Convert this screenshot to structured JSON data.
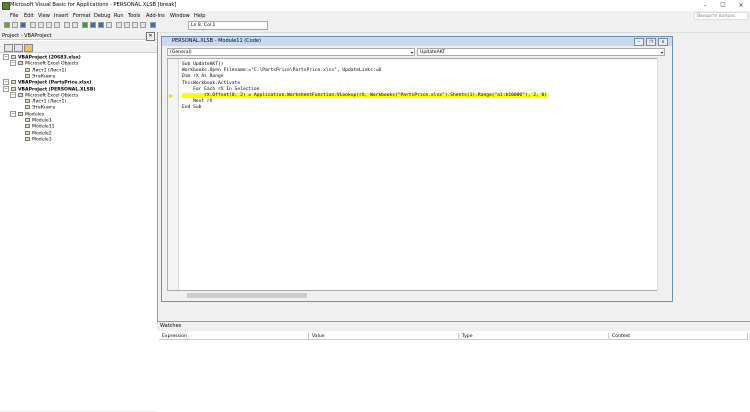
{
  "window": {
    "title": "Microsoft Visual Basic for Applications - PERSONAL.XLSB [break]",
    "controls": [
      "–",
      "☐",
      "✕"
    ]
  },
  "menu": {
    "items": [
      "File",
      "Edit",
      "View",
      "Insert",
      "Format",
      "Debug",
      "Run",
      "Tools",
      "Add-Ins",
      "Window",
      "Help"
    ],
    "ask_placeholder": "Введите вопрос"
  },
  "toolbar": {
    "position": "Ln 8, Col 1"
  },
  "project": {
    "title": "Project - VBAProject",
    "close": "✕",
    "tree": [
      {
        "label": "VBAProject (20683.xlsx)",
        "bold": true,
        "level": 0,
        "icon": "project-icon"
      },
      {
        "label": "Microsoft Excel Objects",
        "bold": false,
        "level": 1,
        "icon": "folder-icon"
      },
      {
        "label": "Лист1 (Лист1)",
        "bold": false,
        "level": 2,
        "icon": "sheet-icon"
      },
      {
        "label": "ЭтаКнига",
        "bold": false,
        "level": 2,
        "icon": "workbook-icon"
      },
      {
        "label": "VBAProject (PartsPrice.xlsx)",
        "bold": true,
        "level": 0,
        "icon": "project-icon"
      },
      {
        "label": "VBAProject (PERSONAL.XLSB)",
        "bold": true,
        "level": 0,
        "icon": "project-icon"
      },
      {
        "label": "Microsoft Excel Objects",
        "bold": false,
        "level": 1,
        "icon": "folder-icon"
      },
      {
        "label": "Лист1 (Лист1)",
        "bold": false,
        "level": 2,
        "icon": "sheet-icon"
      },
      {
        "label": "ЭтаКнига",
        "bold": false,
        "level": 2,
        "icon": "workbook-icon"
      },
      {
        "label": "Modules",
        "bold": false,
        "level": 1,
        "icon": "folder-icon"
      },
      {
        "label": "Module1",
        "bold": false,
        "level": 2,
        "icon": "module-icon"
      },
      {
        "label": "Module11",
        "bold": false,
        "level": 2,
        "icon": "module-icon"
      },
      {
        "label": "Module2",
        "bold": false,
        "level": 2,
        "icon": "module-icon"
      },
      {
        "label": "Module3",
        "bold": false,
        "level": 2,
        "icon": "module-icon"
      }
    ]
  },
  "code_window": {
    "title": "PERSONAL.XLSB - Module11 (Code)",
    "object_combo": "(General)",
    "proc_combo": "UpdateAKT",
    "lines": [
      "Sub UpdateAKT()",
      "Workbooks.Open Filename:=\"C:\\PartsPrice\\PartsPrice.xlsx\", UpdateLinks:=0",
      "Dim rX As Range",
      "ThisWorkbook.Activate",
      "    For Each rX In Selection",
      "        rX.Offset(0, 2) = Application.WorksheetFunction.VLookup(rX, Workbooks(\"PartsPrice.xlsx\").Sheets(1).Range(\"a1:b10000\"), 2, 0)",
      "    Next rX",
      "End Sub"
    ],
    "highlight_line": 5,
    "highlight_color": "#ffff00"
  },
  "watches": {
    "title": "Watches",
    "columns": [
      "Expression",
      "Value",
      "Type",
      "Context"
    ]
  }
}
